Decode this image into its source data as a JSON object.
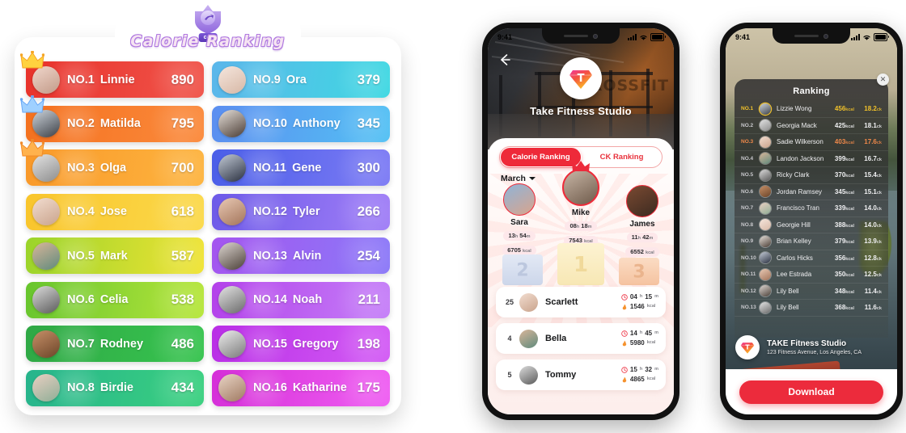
{
  "left_panel": {
    "badge_label": "cal",
    "title": "Calorie Ranking",
    "rows": [
      {
        "no": "NO.1",
        "name": "Linnie",
        "value": "890",
        "c1": "#e8322b",
        "c2": "#f0544a",
        "crown": "gold"
      },
      {
        "no": "NO.2",
        "name": "Matilda",
        "value": "795",
        "c1": "#f4711f",
        "c2": "#fb8a3c",
        "crown": "silver"
      },
      {
        "no": "NO.3",
        "name": "Olga",
        "value": "700",
        "c1": "#f9992a",
        "c2": "#fdb43f",
        "crown": "bronze"
      },
      {
        "no": "NO.4",
        "name": "Jose",
        "value": "618",
        "c1": "#f9c52c",
        "c2": "#fbd94a",
        "crown": ""
      },
      {
        "no": "NO.5",
        "name": "Mark",
        "value": "587",
        "c1": "#9ad42a",
        "c2": "#f0e334",
        "crown": ""
      },
      {
        "no": "NO.6",
        "name": "Celia",
        "value": "538",
        "c1": "#67c52e",
        "c2": "#b7e63a",
        "crown": ""
      },
      {
        "no": "NO.7",
        "name": "Rodney",
        "value": "486",
        "c1": "#2fa845",
        "c2": "#37c44f",
        "crown": ""
      },
      {
        "no": "NO.8",
        "name": "Birdie",
        "value": "434",
        "c1": "#27b48c",
        "c2": "#3ad07f",
        "crown": ""
      },
      {
        "no": "NO.9",
        "name": "Ora",
        "value": "379",
        "c1": "#5bb6ea",
        "c2": "#3fd8e2",
        "crown": ""
      },
      {
        "no": "NO.10",
        "name": "Anthony",
        "value": "345",
        "c1": "#5b8ef0",
        "c2": "#53c1f4",
        "crown": ""
      },
      {
        "no": "NO.11",
        "name": "Gene",
        "value": "300",
        "c1": "#4a5ee8",
        "c2": "#7d7bf5",
        "crown": ""
      },
      {
        "no": "NO.12",
        "name": "Tyler",
        "value": "266",
        "c1": "#6d5ae8",
        "c2": "#a07ef7",
        "crown": ""
      },
      {
        "no": "NO.13",
        "name": "Alvin",
        "value": "254",
        "c1": "#a455ef",
        "c2": "#8b79f8",
        "crown": ""
      },
      {
        "no": "NO.14",
        "name": "Noah",
        "value": "211",
        "c1": "#b341ea",
        "c2": "#c57ff8",
        "crown": ""
      },
      {
        "no": "NO.15",
        "name": "Gregory",
        "value": "198",
        "c1": "#b92ee6",
        "c2": "#d35cf5",
        "crown": ""
      },
      {
        "no": "NO.16",
        "name": "Katharine",
        "value": "175",
        "c1": "#d52fd8",
        "c2": "#ef5ef2",
        "crown": ""
      }
    ]
  },
  "mid_phone": {
    "status": {
      "time": "9:41"
    },
    "back_icon": "back-arrow-icon",
    "studio_name": "Take Fitness Studio",
    "tabs": [
      {
        "label": "Calorie Ranking",
        "active": true
      },
      {
        "label": "CK Ranking",
        "active": false
      }
    ],
    "month": "March",
    "podium": [
      {
        "place": "2",
        "name": "Sara",
        "time": "13",
        "time_u": "h",
        "time2": "54",
        "time2_u": "m",
        "kcal": "6705",
        "kcal_u": "kcal"
      },
      {
        "place": "1",
        "name": "Mike",
        "time": "08",
        "time_u": "h",
        "time2": "18",
        "time2_u": "m",
        "kcal": "7543",
        "kcal_u": "kcal"
      },
      {
        "place": "3",
        "name": "James",
        "time": "11",
        "time_u": "h",
        "time2": "42",
        "time2_u": "m",
        "kcal": "6552",
        "kcal_u": "kcal"
      }
    ],
    "list": [
      {
        "rank": "25",
        "name": "Scarlett",
        "time": "04",
        "time_u": "h",
        "time2": "15",
        "time2_u": "m",
        "kcal": "1546",
        "kcal_u": "kcal"
      },
      {
        "rank": "4",
        "name": "Bella",
        "time": "14",
        "time_u": "h",
        "time2": "45",
        "time2_u": "m",
        "kcal": "5980",
        "kcal_u": "kcal"
      },
      {
        "rank": "5",
        "name": "Tommy",
        "time": "15",
        "time_u": "h",
        "time2": "32",
        "time2_u": "m",
        "kcal": "4865",
        "kcal_u": "kcal"
      }
    ]
  },
  "right_phone": {
    "status": {
      "time": "9:41"
    },
    "close_icon": "close-icon",
    "title": "Ranking",
    "rows": [
      {
        "no": "NO.1",
        "name": "Lizzie Wong",
        "kcal": "456",
        "kcal_u": "kcal",
        "ck": "18.2",
        "ck_u": "ck",
        "hl": "gold"
      },
      {
        "no": "NO.2",
        "name": "Georgia Mack",
        "kcal": "425",
        "kcal_u": "kcal",
        "ck": "18.1",
        "ck_u": "ck",
        "hl": ""
      },
      {
        "no": "NO.3",
        "name": "Sadie Wilkerson",
        "kcal": "403",
        "kcal_u": "kcal",
        "ck": "17.6",
        "ck_u": "ck",
        "hl": "bronze"
      },
      {
        "no": "NO.4",
        "name": "Landon Jackson",
        "kcal": "399",
        "kcal_u": "kcal",
        "ck": "16.7",
        "ck_u": "ck",
        "hl": ""
      },
      {
        "no": "NO.5",
        "name": "Ricky Clark",
        "kcal": "370",
        "kcal_u": "kcal",
        "ck": "15.4",
        "ck_u": "ck",
        "hl": ""
      },
      {
        "no": "NO.6",
        "name": "Jordan Ramsey",
        "kcal": "345",
        "kcal_u": "kcal",
        "ck": "15.1",
        "ck_u": "ck",
        "hl": ""
      },
      {
        "no": "NO.7",
        "name": "Francisco Tran",
        "kcal": "339",
        "kcal_u": "kcal",
        "ck": "14.0",
        "ck_u": "ck",
        "hl": ""
      },
      {
        "no": "NO.8",
        "name": "Georgie Hill",
        "kcal": "388",
        "kcal_u": "kcal",
        "ck": "14.0",
        "ck_u": "ck",
        "hl": ""
      },
      {
        "no": "NO.9",
        "name": "Brian Kelley",
        "kcal": "379",
        "kcal_u": "kcal",
        "ck": "13.9",
        "ck_u": "ck",
        "hl": ""
      },
      {
        "no": "NO.10",
        "name": "Carlos Hicks",
        "kcal": "356",
        "kcal_u": "kcal",
        "ck": "12.8",
        "ck_u": "ck",
        "hl": ""
      },
      {
        "no": "NO.11",
        "name": "Lee Estrada",
        "kcal": "350",
        "kcal_u": "kcal",
        "ck": "12.5",
        "ck_u": "ck",
        "hl": ""
      },
      {
        "no": "NO.12",
        "name": "Lily Bell",
        "kcal": "348",
        "kcal_u": "kcal",
        "ck": "11.4",
        "ck_u": "ck",
        "hl": ""
      },
      {
        "no": "NO.13",
        "name": "Lily Bell",
        "kcal": "368",
        "kcal_u": "kcal",
        "ck": "11.6",
        "ck_u": "ck",
        "hl": ""
      }
    ],
    "studio_title": "TAKE Fitness Studio",
    "studio_address": "123 Fitness Avenue, Los Angeles, CA",
    "download_label": "Download"
  },
  "colors": {
    "accent_red": "#ec2b3c",
    "gold": "#f2c22a",
    "bronze": "#f0894a"
  }
}
